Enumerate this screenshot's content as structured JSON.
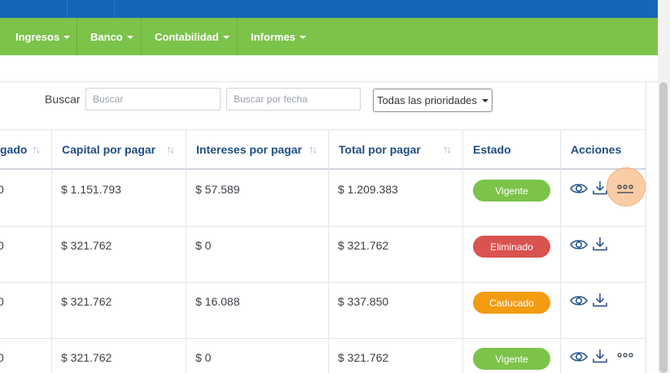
{
  "menu": {
    "items": [
      {
        "label": "Ingresos"
      },
      {
        "label": "Banco"
      },
      {
        "label": "Contabilidad"
      },
      {
        "label": "Informes"
      }
    ]
  },
  "filters": {
    "search_label": "Buscar",
    "search_placeholder": "Buscar",
    "date_placeholder": "Buscar por fecha",
    "priority_select": "Todas las prioridades"
  },
  "table": {
    "headers": [
      "gado",
      "Capital por pagar",
      "Intereses por pagar",
      "Total por pagar",
      "Estado",
      "Acciones"
    ],
    "rows": [
      {
        "paid_partial": "0",
        "capital": "$ 1.151.793",
        "interest": "$ 57.589",
        "total": "$ 1.209.383",
        "status": "Vigente"
      },
      {
        "paid_partial": "0",
        "capital": "$ 321.762",
        "interest": "$ 0",
        "total": "$ 321.762",
        "status": "Eliminado"
      },
      {
        "paid_partial": "0",
        "capital": "$ 321.762",
        "interest": "$ 16.088",
        "total": "$ 337.850",
        "status": "Caducado"
      },
      {
        "paid_partial": "0",
        "capital": "$ 321.762",
        "interest": "$ 0",
        "total": "$ 321.762",
        "status": "Vigente"
      }
    ]
  },
  "colors": {
    "topbar": "#1565b8",
    "menubar": "#7cc34a",
    "header_text": "#1f4e85",
    "status_vigente": "#7cc34a",
    "status_eliminado": "#d9534f",
    "status_caducado": "#f39c12",
    "action_icon": "#1f4e85"
  },
  "icons": {
    "view": "eye-icon",
    "download": "download-icon",
    "more": "more-options-icon",
    "sort": "sort-arrows-icon",
    "caret": "caret-down-icon"
  }
}
